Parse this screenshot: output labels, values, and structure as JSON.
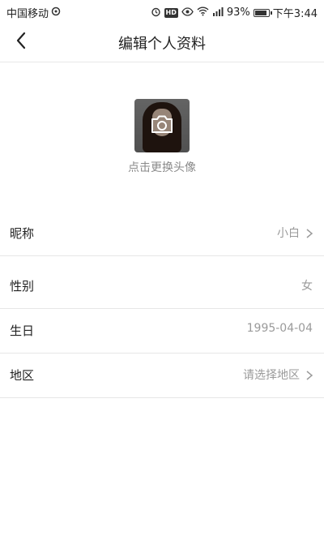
{
  "status_bar": {
    "carrier": "中国移动",
    "battery": "93%",
    "battery_level": 0.93,
    "time": "下午3:44",
    "hd_badge": "HD"
  },
  "nav": {
    "title": "编辑个人资料"
  },
  "avatar": {
    "caption": "点击更换头像"
  },
  "rows": [
    {
      "label": "昵称",
      "value": "小白",
      "has_arrow": true
    },
    {
      "label": "性别",
      "value": "女",
      "has_arrow": false
    },
    {
      "label": "生日",
      "value": "1995-04-04",
      "has_arrow": false
    },
    {
      "label": "地区",
      "value": "请选择地区",
      "has_arrow": true
    }
  ]
}
